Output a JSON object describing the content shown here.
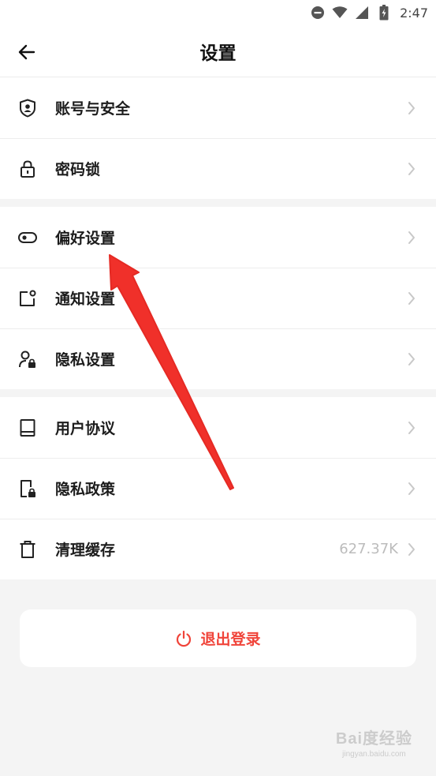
{
  "status_bar": {
    "time": "2:47",
    "icons": [
      "dnd-icon",
      "wifi-icon",
      "signal-icon",
      "battery-charging-icon"
    ]
  },
  "header": {
    "title": "设置",
    "back_icon": "arrow-left-icon"
  },
  "groups": [
    {
      "items": [
        {
          "label": "账号与安全",
          "icon": "shield-user-icon"
        },
        {
          "label": "密码锁",
          "icon": "lock-icon"
        }
      ]
    },
    {
      "items": [
        {
          "label": "偏好设置",
          "icon": "toggle-icon"
        },
        {
          "label": "通知设置",
          "icon": "notification-icon"
        },
        {
          "label": "隐私设置",
          "icon": "user-lock-icon"
        }
      ]
    },
    {
      "items": [
        {
          "label": "用户协议",
          "icon": "book-icon"
        },
        {
          "label": "隐私政策",
          "icon": "document-lock-icon"
        },
        {
          "label": "清理缓存",
          "icon": "trash-icon",
          "value": "627.37K"
        }
      ]
    }
  ],
  "logout": {
    "label": "退出登录",
    "icon": "power-icon",
    "color": "#f0443a"
  },
  "annotation": {
    "arrow_color": "#f0302a",
    "target": "偏好设置"
  },
  "watermark": {
    "logo": "Bai度经验",
    "url": "jingyan.baidu.com"
  },
  "colors": {
    "accent": "#f0443a",
    "background": "#f4f4f4",
    "card": "#ffffff",
    "secondary_text": "#bcbcbc"
  }
}
